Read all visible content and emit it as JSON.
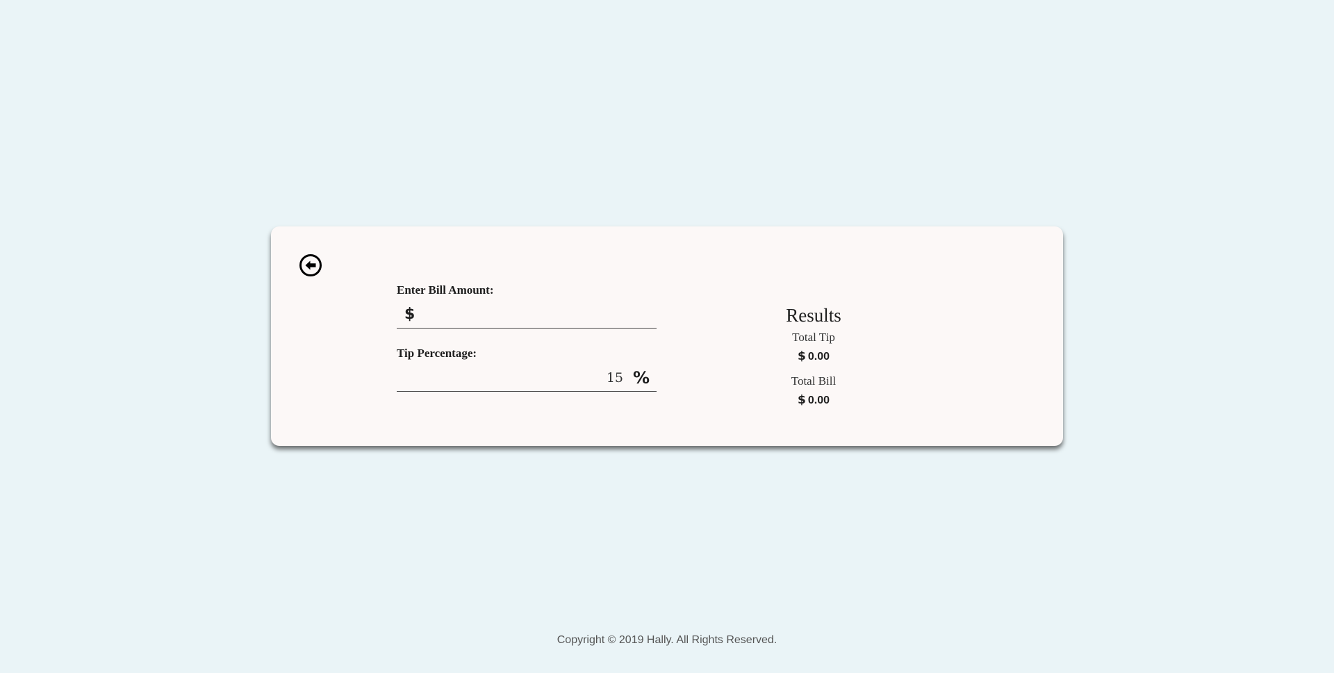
{
  "form": {
    "bill_label": "Enter Bill Amount:",
    "bill_currency": "$",
    "bill_value": "",
    "tip_label": "Tip Percentage:",
    "tip_value": "15",
    "tip_unit": "%"
  },
  "results": {
    "title": "Results",
    "total_tip_label": "Total Tip",
    "total_tip_currency": "$",
    "total_tip_value": "0.00",
    "total_bill_label": "Total Bill",
    "total_bill_currency": "$",
    "total_bill_value": "0.00"
  },
  "footer": {
    "copyright": "Copyright © 2019 Hally. All Rights Reserved."
  },
  "icons": {
    "back": "arrow-left-circle-icon"
  },
  "colors": {
    "page_background": "#eaf4f7",
    "card_background": "#fcf8f7",
    "text": "#1e1e1e"
  }
}
